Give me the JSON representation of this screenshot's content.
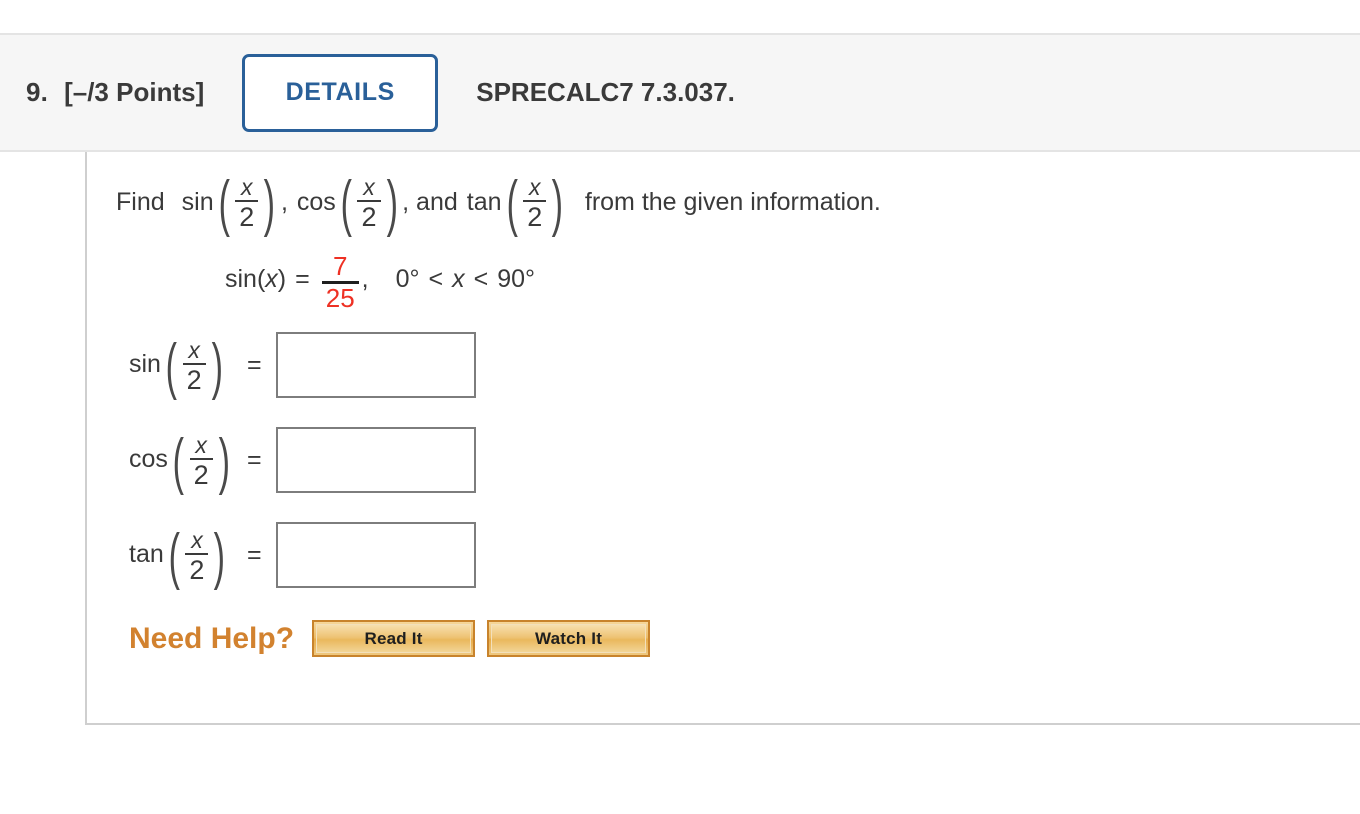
{
  "header": {
    "question_number": "9.",
    "points": "[–/3 Points]",
    "details_label": "DETAILS",
    "textbook_code": "SPRECALC7 7.3.037."
  },
  "problem": {
    "prompt": {
      "lead": "Find",
      "fn1": "sin",
      "fn2": "cos",
      "fn3": "tan",
      "conj": ", and",
      "comma": ",",
      "arg_numerator": "x",
      "arg_denominator": "2",
      "tail": "from the given information."
    },
    "given": {
      "function": "sin(",
      "variable": "x",
      "close_paren": ")",
      "equals": "=",
      "fraction_numerator": "7",
      "fraction_denominator": "25",
      "comma": ",",
      "domain_lower": "0°",
      "domain_rel1": "<",
      "domain_variable": "x",
      "domain_rel2": "<",
      "domain_upper": "90°",
      "fraction_color": "#ee3124"
    }
  },
  "answers": [
    {
      "function": "sin",
      "arg_numerator": "x",
      "arg_denominator": "2",
      "equals": "=",
      "value": "",
      "placeholder": ""
    },
    {
      "function": "cos",
      "arg_numerator": "x",
      "arg_denominator": "2",
      "equals": "=",
      "value": "",
      "placeholder": ""
    },
    {
      "function": "tan",
      "arg_numerator": "x",
      "arg_denominator": "2",
      "equals": "=",
      "value": "",
      "placeholder": ""
    }
  ],
  "help": {
    "label": "Need Help?",
    "read_button": "Read It",
    "watch_button": "Watch It",
    "label_color": "#d2822f"
  }
}
